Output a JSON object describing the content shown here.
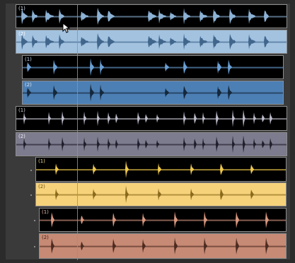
{
  "colors": {
    "background": "#2b2b2b",
    "clip_border": "#8d8d8d",
    "playhead": "#9b8f8f",
    "blue_wave": "#8cb2d5",
    "blue_fill": "#a2c2e0",
    "steel_fill": "#4c7fb4",
    "gray_fill": "#7d7b8e",
    "gray_wave": "#bdbcca",
    "yellow_fill": "#f6d27a",
    "yellow_wave": "#f0c94d",
    "salmon_fill": "#c68a75",
    "salmon_wave": "#d8977f"
  },
  "cursor": {
    "icon": "mouse-pointer-icon"
  },
  "tracks": [
    {
      "id": "t1",
      "label": "(1)",
      "selected": false,
      "fill": "#000000",
      "wave": "#8cb2d5",
      "label_color": "#d9e4ef",
      "pattern": "speech",
      "seed": 1
    },
    {
      "id": "t2",
      "label": "(2)",
      "selected": true,
      "fill": "#a2c2e0",
      "wave": "#41668c",
      "label_color": "#ffffff",
      "pattern": "speech",
      "seed": 1
    },
    {
      "id": "t3",
      "label": "(1)",
      "selected": false,
      "fill": "#000000",
      "wave": "#6a9fd3",
      "label_color": "#c5d6e8",
      "pattern": "bursts",
      "seed": 2
    },
    {
      "id": "t4",
      "label": "(2)",
      "selected": true,
      "fill": "#4c7fb4",
      "wave": "#14283c",
      "label_color": "#dde8f3",
      "pattern": "bursts",
      "seed": 2
    },
    {
      "id": "t5",
      "label": "(1)",
      "selected": false,
      "fill": "#000000",
      "wave": "#bdbcca",
      "label_color": "#d0d0d8",
      "pattern": "clusters",
      "seed": 3
    },
    {
      "id": "t6",
      "label": "(2)",
      "selected": true,
      "fill": "#7d7b8e",
      "wave": "#1f1e2a",
      "label_color": "#ededf2",
      "pattern": "clusters",
      "seed": 3
    },
    {
      "id": "t7",
      "label": "(1)",
      "selected": false,
      "fill": "#000000",
      "wave": "#f0c94d",
      "label_color": "#f0d890",
      "pattern": "spikes",
      "seed": 4
    },
    {
      "id": "t8",
      "label": "(2)",
      "selected": true,
      "fill": "#f6d27a",
      "wave": "#8a6a1c",
      "label_color": "#6b5316",
      "pattern": "spikes",
      "seed": 4
    },
    {
      "id": "t9",
      "label": "(1)",
      "selected": false,
      "fill": "#000000",
      "wave": "#d8977f",
      "label_color": "#e8b9a8",
      "pattern": "spikes_small",
      "seed": 5
    },
    {
      "id": "t10",
      "label": "(2)",
      "selected": true,
      "fill": "#c68a75",
      "wave": "#4d2b20",
      "label_color": "#3b2018",
      "pattern": "spikes_small",
      "seed": 5
    }
  ]
}
